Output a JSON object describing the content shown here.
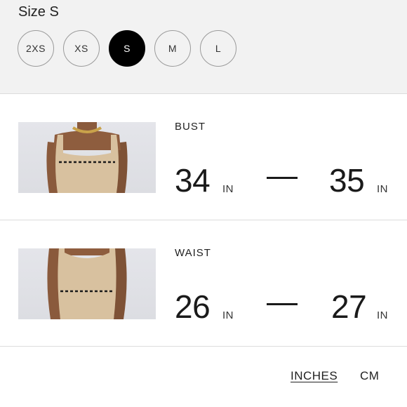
{
  "size_selector": {
    "title": "Size S",
    "options": [
      {
        "label": "2XS",
        "selected": false
      },
      {
        "label": "XS",
        "selected": false
      },
      {
        "label": "S",
        "selected": true
      },
      {
        "label": "M",
        "selected": false
      },
      {
        "label": "L",
        "selected": false
      }
    ]
  },
  "measurements": [
    {
      "label": "BUST",
      "min": "34",
      "min_unit": "IN",
      "max": "35",
      "max_unit": "IN"
    },
    {
      "label": "WAIST",
      "min": "26",
      "min_unit": "IN",
      "max": "27",
      "max_unit": "IN"
    }
  ],
  "unit_toggle": {
    "inches": "INCHES",
    "cm": "CM",
    "active": "inches"
  },
  "colors": {
    "panel_bg": "#f2f2f2",
    "selected_bg": "#000000",
    "garment": "#d8c19f",
    "skin": "#8a5a3c",
    "measure_line": "#1a1a1a"
  }
}
